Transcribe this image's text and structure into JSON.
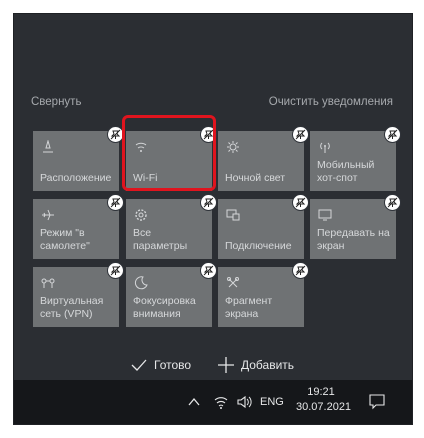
{
  "header": {
    "collapse": "Свернуть",
    "clear": "Очистить уведомления"
  },
  "tiles": [
    {
      "label": "Расположение",
      "icon": "location-icon"
    },
    {
      "label": "Wi-Fi",
      "icon": "wifi-icon"
    },
    {
      "label": "Ночной свет",
      "icon": "night-light-icon"
    },
    {
      "label": "Мобильный хот-спот",
      "icon": "mobile-hotspot-icon"
    },
    {
      "label": "Режим \"в самолете\"",
      "icon": "airplane-icon"
    },
    {
      "label": "Все параметры",
      "icon": "settings-icon"
    },
    {
      "label": "Подключение",
      "icon": "connect-icon"
    },
    {
      "label": "Передавать на экран",
      "icon": "project-icon"
    },
    {
      "label": "Виртуальная сеть (VPN)",
      "icon": "vpn-icon"
    },
    {
      "label": "Фокусировка внимания",
      "icon": "focus-assist-icon"
    },
    {
      "label": "Фрагмент экрана",
      "icon": "screen-snip-icon"
    }
  ],
  "actions": {
    "done": "Готово",
    "add": "Добавить"
  },
  "taskbar": {
    "language": "ENG",
    "time": "19:21",
    "date": "30.07.2021"
  },
  "colors": {
    "highlight": "#e0141e",
    "tile": "#6f7274",
    "panel": "#2b2e33",
    "taskbar": "#15171a"
  }
}
